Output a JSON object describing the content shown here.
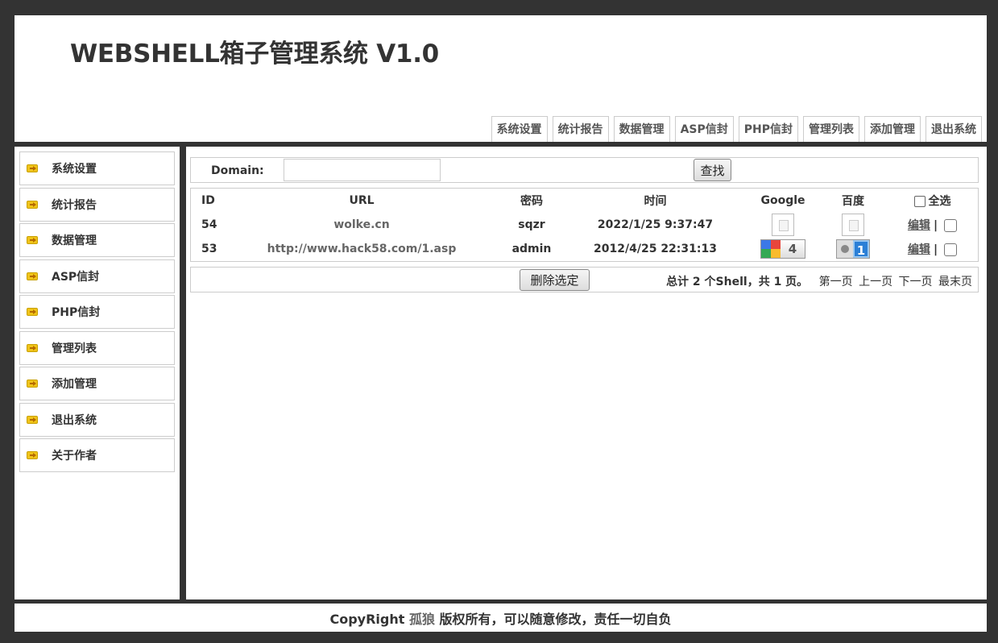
{
  "header": {
    "title": "WEBSHELL箱子管理系统 V1.0",
    "nav": [
      "系统设置",
      "统计报告",
      "数据管理",
      "ASP信封",
      "PHP信封",
      "管理列表",
      "添加管理",
      "退出系统"
    ]
  },
  "sidebar": {
    "items": [
      "系统设置",
      "统计报告",
      "数据管理",
      "ASP信封",
      "PHP信封",
      "管理列表",
      "添加管理",
      "退出系统",
      "关于作者"
    ]
  },
  "search": {
    "label": "Domain:",
    "value": "",
    "button": "查找"
  },
  "table": {
    "headers": {
      "id": "ID",
      "url": "URL",
      "password": "密码",
      "time": "时间",
      "google": "Google",
      "baidu": "百度",
      "select_all": "全选"
    },
    "rows": [
      {
        "id": "54",
        "url": "wolke.cn",
        "password": "sqzr",
        "time": "2022/1/25 9:37:47",
        "google_rank": "",
        "baidu_rank": "",
        "edit": "编辑",
        "sep": "|"
      },
      {
        "id": "53",
        "url": "http://www.hack58.com/1.asp",
        "password": "admin",
        "time": "2012/4/25 22:31:13",
        "google_rank": "4",
        "baidu_rank": "1",
        "edit": "编辑",
        "sep": "|"
      }
    ]
  },
  "footer_bar": {
    "delete_button": "删除选定",
    "total": "总计 2 个Shell，共 1 页。",
    "pages": [
      "第一页",
      "上一页",
      "下一页",
      "最末页"
    ]
  },
  "copyright": {
    "prefix": "CopyRight ",
    "author": "孤狼",
    "suffix": " 版权所有，可以随意修改，责任一切自负"
  }
}
